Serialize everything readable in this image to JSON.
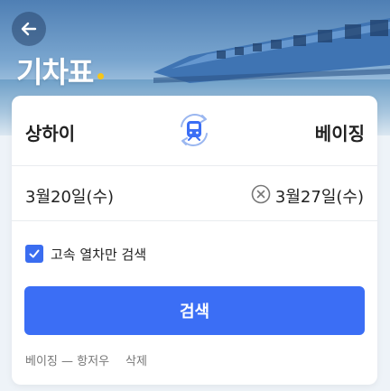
{
  "header": {
    "title": "기차표",
    "back_icon": "arrow-left-icon",
    "accent_dot_color": "#f5c518"
  },
  "route": {
    "from": "상하이",
    "to": "베이징",
    "swap_icon": "train-swap-icon"
  },
  "dates": {
    "departure": "3월20일(수)",
    "return": "3월27일(수)",
    "clear_icon": "clear-circle-icon"
  },
  "options": {
    "high_speed_only_label": "고속 열차만 검색",
    "high_speed_only_checked": true
  },
  "search_button": {
    "label": "검색",
    "color": "#3b6ef5"
  },
  "history": {
    "recent_route": "베이징 — 항저우",
    "delete_label": "삭제"
  }
}
